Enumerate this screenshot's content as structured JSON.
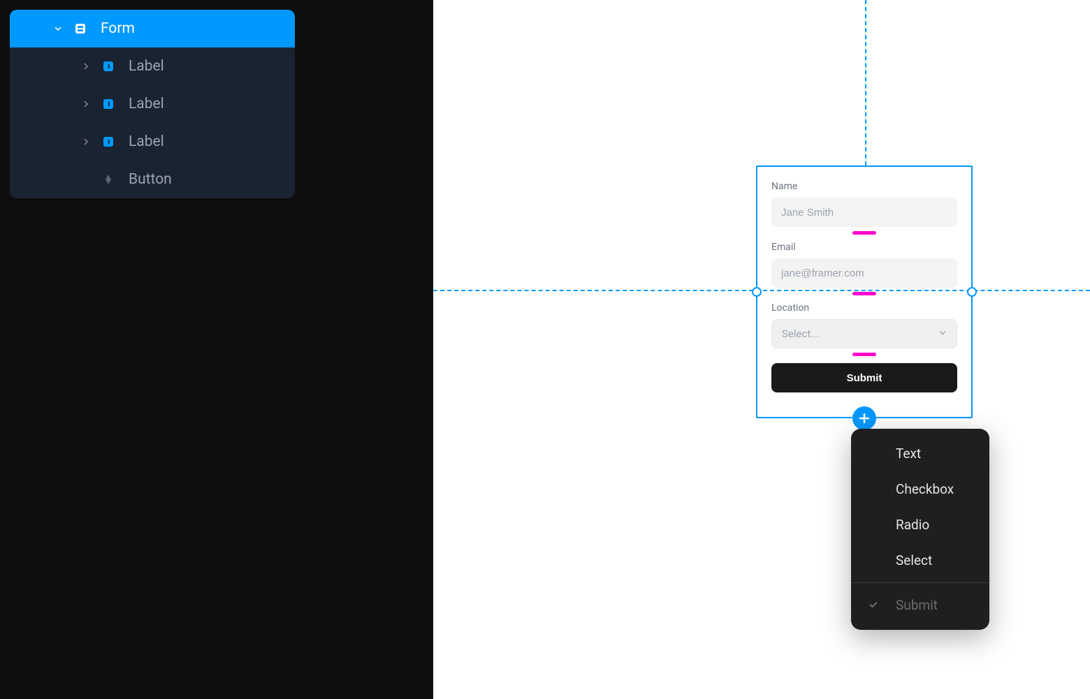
{
  "layers": {
    "root": {
      "label": "Form",
      "expanded": true
    },
    "children": [
      {
        "label": "Label",
        "icon": "component"
      },
      {
        "label": "Label",
        "icon": "component"
      },
      {
        "label": "Label",
        "icon": "component"
      },
      {
        "label": "Button",
        "icon": "diamond"
      }
    ]
  },
  "form": {
    "fields": [
      {
        "label": "Name",
        "placeholder": "Jane Smith",
        "type": "text"
      },
      {
        "label": "Email",
        "placeholder": "jane@framer.com",
        "type": "text"
      },
      {
        "label": "Location",
        "placeholder": "Select...",
        "type": "select"
      }
    ],
    "submit_label": "Submit"
  },
  "menu": {
    "items": [
      {
        "label": "Text"
      },
      {
        "label": "Checkbox"
      },
      {
        "label": "Radio"
      },
      {
        "label": "Select"
      }
    ],
    "submit": {
      "label": "Submit",
      "checked": true
    }
  }
}
